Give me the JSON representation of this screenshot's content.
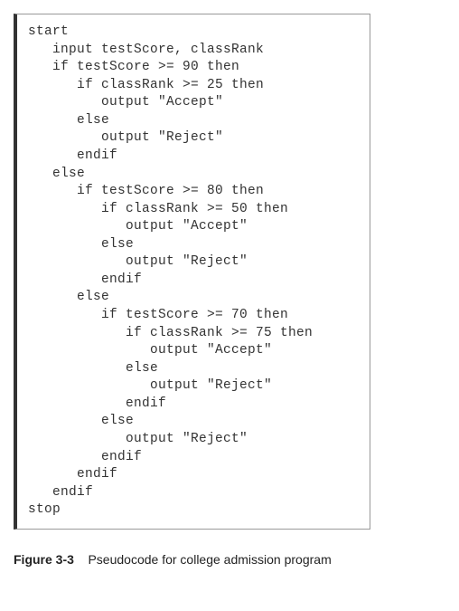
{
  "code": {
    "lines": [
      "start",
      "   input testScore, classRank",
      "   if testScore >= 90 then",
      "      if classRank >= 25 then",
      "         output \"Accept\"",
      "      else",
      "         output \"Reject\"",
      "      endif",
      "   else",
      "      if testScore >= 80 then",
      "         if classRank >= 50 then",
      "            output \"Accept\"",
      "         else",
      "            output \"Reject\"",
      "         endif",
      "      else",
      "         if testScore >= 70 then",
      "            if classRank >= 75 then",
      "               output \"Accept\"",
      "            else",
      "               output \"Reject\"",
      "            endif",
      "         else",
      "            output \"Reject\"",
      "         endif",
      "      endif",
      "   endif",
      "stop"
    ]
  },
  "caption": {
    "label": "Figure 3-3",
    "text": "Pseudocode for college admission program"
  }
}
